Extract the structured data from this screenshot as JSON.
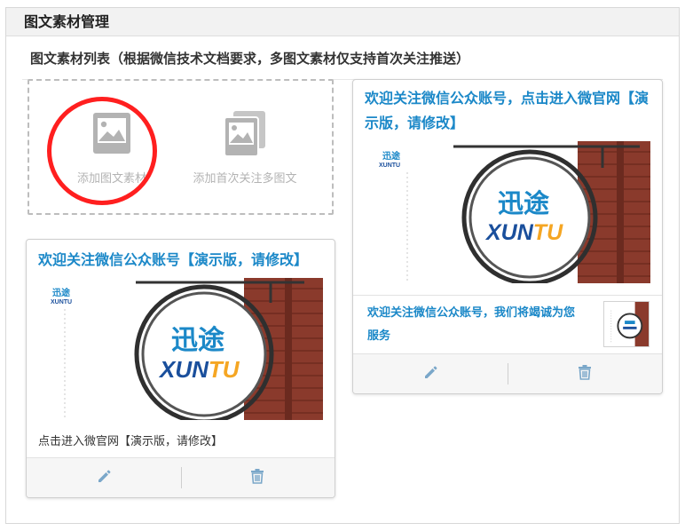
{
  "panel": {
    "title": "图文素材管理",
    "list_caption": "图文素材列表（根据微信技术文档要求，多图文素材仅支持首次关注推送）"
  },
  "add_actions": {
    "single_label": "添加图文素材",
    "multi_label": "添加首次关注多图文"
  },
  "cards": [
    {
      "title": "欢迎关注微信公众账号【演示版，请修改】",
      "description": "点击进入微官网【演示版，请修改】",
      "cover_logo_cn": "迅途",
      "cover_logo_en": "XUNTU"
    },
    {
      "title": "欢迎关注微信公众账号，点击进入微官网【演示版，请修改】",
      "cover_logo_cn": "迅途",
      "cover_logo_en": "XUNTU",
      "sub_item_title": "欢迎关注微信公众账号，我们将竭诚为您服务"
    }
  ],
  "theme": {
    "accent": "#1b88c8",
    "highlight_circle": "#ff1f1f",
    "icon_gray": "#b3b3b3"
  },
  "icons": {
    "single_add": "image-icon",
    "multi_add": "images-stack-icon",
    "edit": "pencil-icon",
    "delete": "trash-icon"
  }
}
